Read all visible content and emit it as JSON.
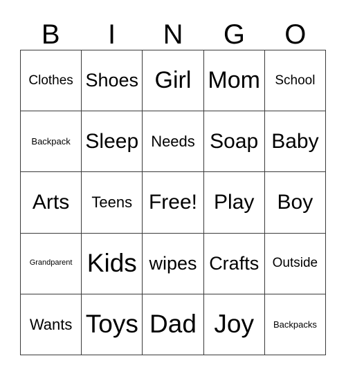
{
  "card": {
    "title_letters": [
      "B",
      "I",
      "N",
      "G",
      "O"
    ],
    "free_space_label": "Free!",
    "colors": {
      "background": "#ffffff",
      "text": "#000000",
      "border": "#3a3a3a"
    },
    "rows": [
      [
        {
          "label": "Clothes",
          "size": "fs-m"
        },
        {
          "label": "Shoes",
          "size": "fs-l"
        },
        {
          "label": "Girl",
          "size": "fs-xxl"
        },
        {
          "label": "Mom",
          "size": "fs-xxl"
        },
        {
          "label": "School",
          "size": "fs-m"
        }
      ],
      [
        {
          "label": "Backpack",
          "size": "fs-s"
        },
        {
          "label": "Sleep",
          "size": "fs-xl"
        },
        {
          "label": "Needs",
          "size": "fs-ml"
        },
        {
          "label": "Soap",
          "size": "fs-xl"
        },
        {
          "label": "Baby",
          "size": "fs-xl"
        }
      ],
      [
        {
          "label": "Arts",
          "size": "fs-xl"
        },
        {
          "label": "Teens",
          "size": "fs-ml"
        },
        {
          "label": "Free!",
          "size": "fs-xl"
        },
        {
          "label": "Play",
          "size": "fs-xl"
        },
        {
          "label": "Boy",
          "size": "fs-xl"
        }
      ],
      [
        {
          "label": "Grandparent",
          "size": "fs-xs"
        },
        {
          "label": "Kids",
          "size": "fs-xxxl"
        },
        {
          "label": "wipes",
          "size": "fs-l"
        },
        {
          "label": "Crafts",
          "size": "fs-l"
        },
        {
          "label": "Outside",
          "size": "fs-m"
        }
      ],
      [
        {
          "label": "Wants",
          "size": "fs-ml"
        },
        {
          "label": "Toys",
          "size": "fs-xxxl"
        },
        {
          "label": "Dad",
          "size": "fs-xxxl"
        },
        {
          "label": "Joy",
          "size": "fs-xxxl"
        },
        {
          "label": "Backpacks",
          "size": "fs-s"
        }
      ]
    ]
  }
}
